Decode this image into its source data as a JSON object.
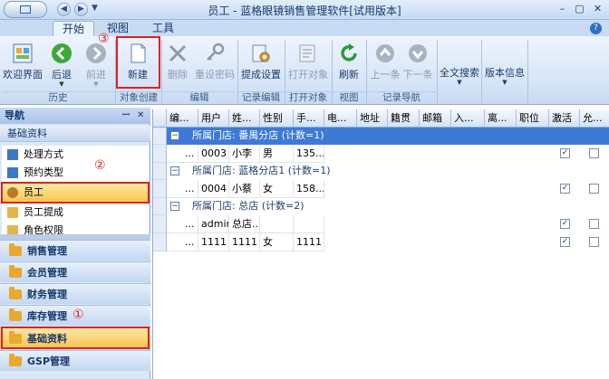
{
  "window": {
    "title": "员工 - 蓝格眼镜销售管理软件[试用版本]"
  },
  "tabs": [
    "开始",
    "视图",
    "工具"
  ],
  "ribbon": {
    "buttons": {
      "welcome": "欢迎界面",
      "back": "后退",
      "forward": "前进",
      "new": "新建",
      "delete": "删除",
      "reset_pwd": "重设密码",
      "commission": "提成设置",
      "open_obj": "打开对象",
      "refresh": "刷新",
      "prev": "上一条",
      "next": "下一条",
      "search": "全文搜索",
      "version": "版本信息"
    },
    "groups": {
      "history": "历史",
      "create": "对象创建",
      "edit": "编辑",
      "record_edit": "记录编辑",
      "open_obj": "打开对象",
      "view": "视图",
      "record_nav": "记录导航"
    }
  },
  "annotations": [
    "①",
    "②",
    "③"
  ],
  "nav": {
    "title": "导航",
    "pin": "ꟷ",
    "close": "✕",
    "section": "基础资料",
    "items": [
      "处理方式",
      "预约类型",
      "员工",
      "员工提成",
      "角色权限"
    ],
    "buttons": [
      "销售管理",
      "会员管理",
      "财务管理",
      "库存管理",
      "基础资料",
      "GSP管理"
    ]
  },
  "grid": {
    "columns": [
      "编...",
      "用户",
      "姓...",
      "性别",
      "手...",
      "电...",
      "地址",
      "籍贯",
      "邮箱",
      "入...",
      "离...",
      "职位",
      "激活",
      "允..."
    ],
    "groups": [
      {
        "label": "所属门店: 番禺分店 (计数=1)",
        "toggle": "−",
        "rows": [
          {
            "code": "...",
            "user": "0003",
            "name": "小李",
            "gender": "男",
            "phone": "135...",
            "active": "✓"
          }
        ]
      },
      {
        "label": "所属门店: 蓝格分店1 (计数=1)",
        "toggle": "−",
        "rows": [
          {
            "code": "...",
            "user": "0004",
            "name": "小蔡",
            "gender": "女",
            "phone": "158...",
            "active": "✓"
          }
        ]
      },
      {
        "label": "所属门店: 总店 (计数=2)",
        "toggle": "−",
        "rows": [
          {
            "code": "...",
            "user": "admin",
            "name": "总店...",
            "gender": "",
            "phone": "",
            "active": "✓"
          },
          {
            "code": "...",
            "user": "1111",
            "name": "1111",
            "gender": "女",
            "phone": "1111",
            "active": "✓"
          }
        ]
      }
    ]
  },
  "colors": {
    "accent": "#3d7ad6",
    "highlight": "#e02020",
    "nav_active": "#f8c24a"
  }
}
